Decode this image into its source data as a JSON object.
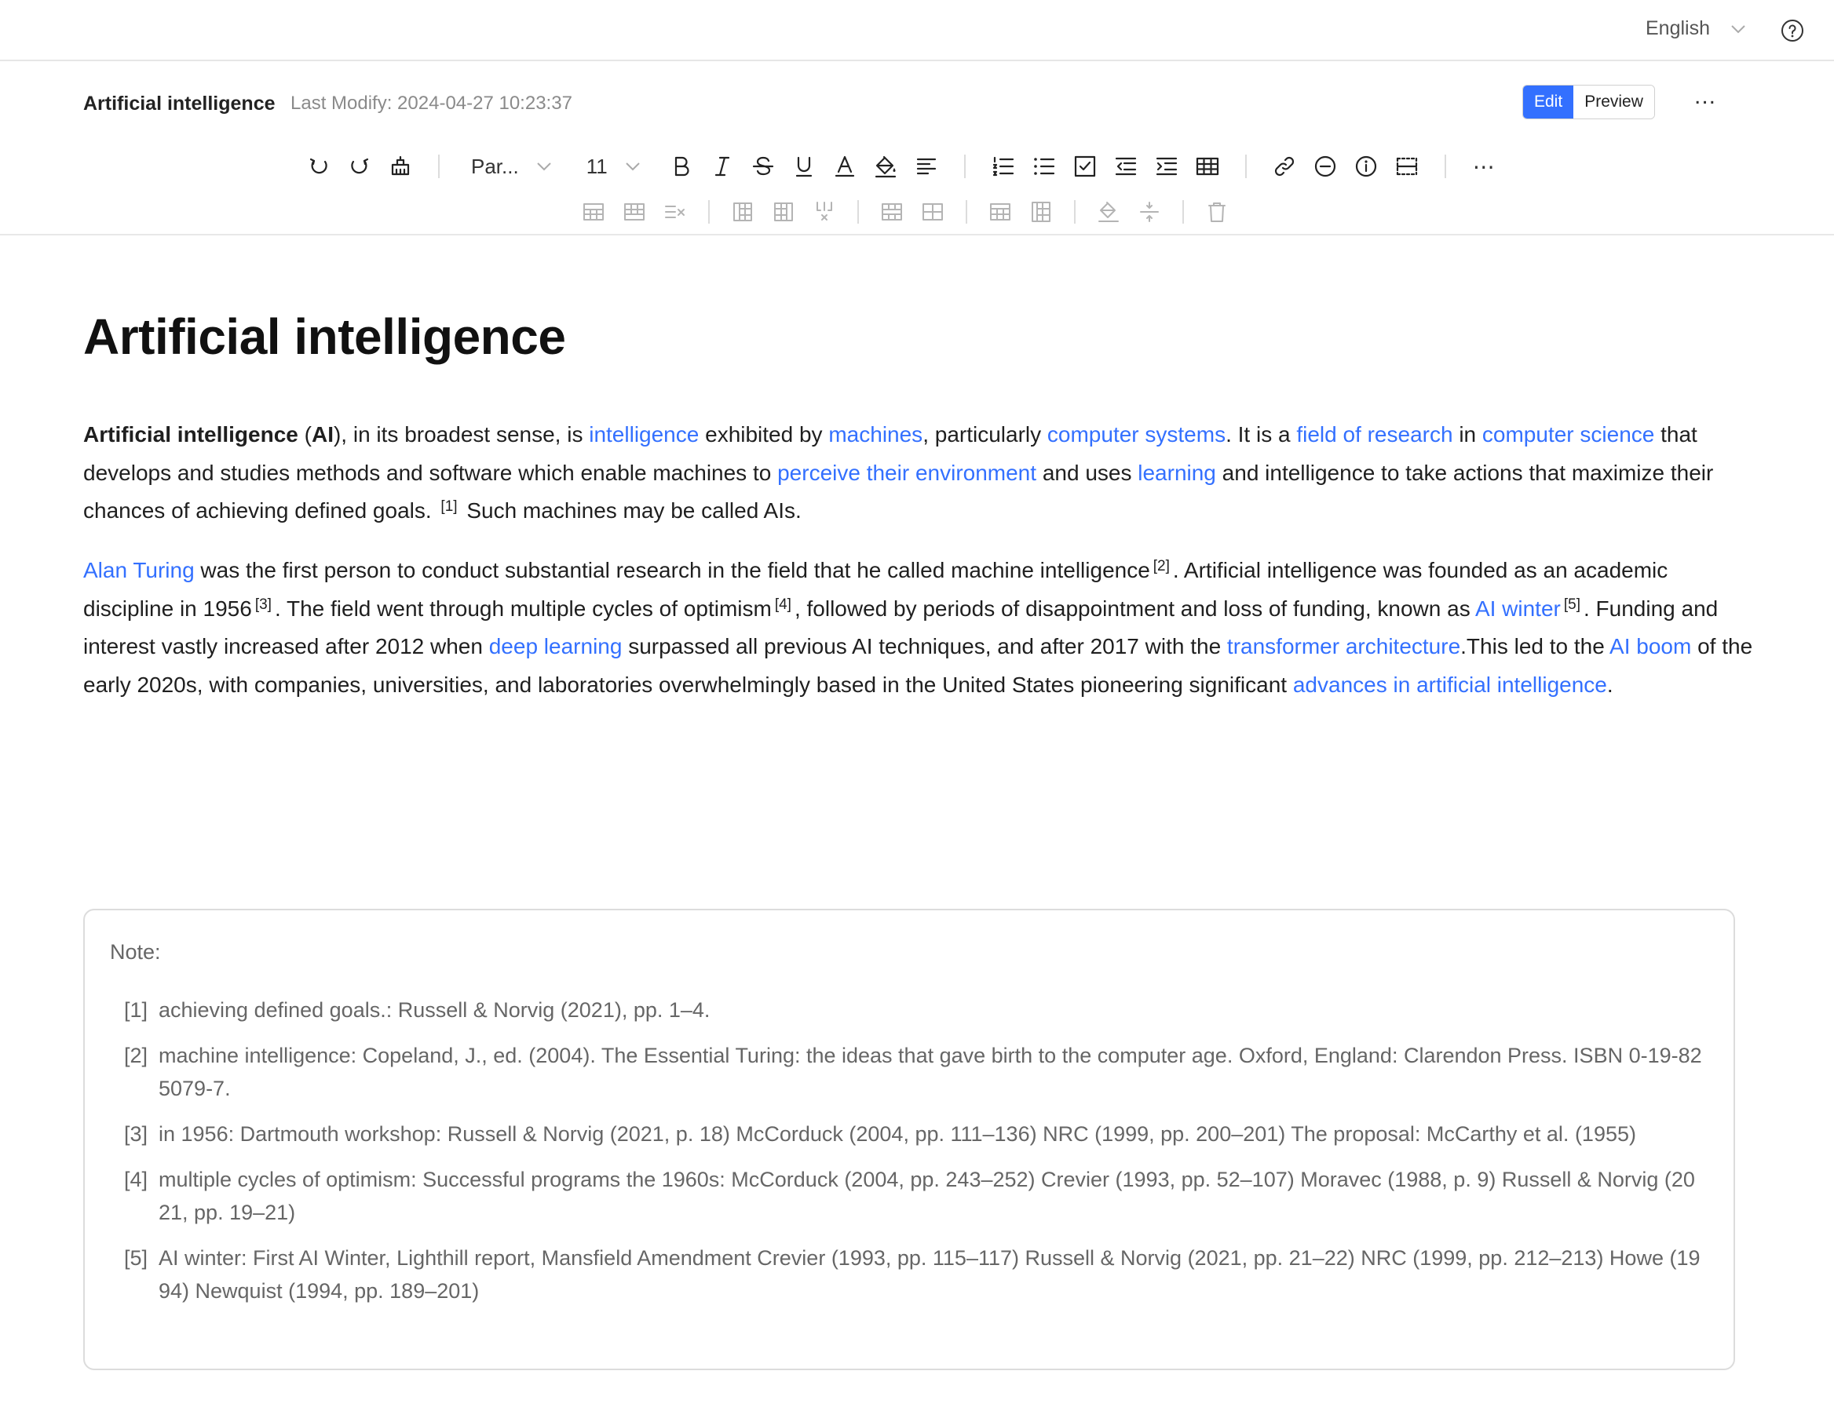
{
  "topbar": {
    "language": "English"
  },
  "header": {
    "doc_name": "Artificial intelligence",
    "last_modify": "Last Modify: 2024-04-27 10:23:37",
    "edit_label": "Edit",
    "preview_label": "Preview",
    "more_label": "..."
  },
  "toolbar": {
    "paragraph_select": "Par...",
    "font_size": "11",
    "more_label": "⋯",
    "icons_row1": [
      "undo-icon",
      "redo-icon",
      "clear-format-icon",
      "bold-icon",
      "italic-icon",
      "strikethrough-icon",
      "underline-icon",
      "font-color-icon",
      "highlight-icon",
      "align-icon",
      "ordered-list-icon",
      "bullet-list-icon",
      "checkbox-icon",
      "outdent-icon",
      "indent-icon",
      "table-icon",
      "link-icon",
      "horizontal-rule-icon",
      "info-icon",
      "select-all-icon"
    ],
    "icons_row2": [
      "insert-row-above-icon",
      "insert-row-below-icon",
      "delete-row-icon",
      "insert-column-left-icon",
      "insert-column-right-icon",
      "delete-column-icon",
      "merge-cells-icon",
      "split-cells-icon",
      "header-row-icon",
      "header-column-icon",
      "cell-fill-icon",
      "distribute-icon",
      "delete-table-icon"
    ]
  },
  "document": {
    "title": "Artificial intelligence",
    "p1": {
      "t1": "Artificial intelligence",
      "t2": " (",
      "t3": "AI",
      "t4": "), in its broadest sense, is ",
      "l1": "intelligence",
      "t5": " exhibited by ",
      "l2": "machines",
      "t6": ", particularly ",
      "l3": "computer systems",
      "t7": ". It is a ",
      "l4": "field of research",
      "t8": " in ",
      "l5": "computer science",
      "t9": " that develops and studies methods and software which enable machines to ",
      "l6": "perceive their environment",
      "t10": " and uses ",
      "l7": "learning",
      "t11": " and intelligence to take actions that maximize their chances of achieving defined goals. ",
      "r1": "[1]",
      "t12": " Such machines may be called AIs."
    },
    "p2": {
      "l1": "Alan Turing",
      "t1": " was the first person to conduct substantial research in the field that he called machine intelligence",
      "r2": "[2]",
      "t2": ". Artificial intelligence was founded as an academic discipline in 1956",
      "r3": "[3]",
      "t3": ". The field went through multiple cycles of optimism",
      "r4": "[4]",
      "t4": ", followed by periods of disappointment and loss of funding, known as ",
      "l2": "AI winter",
      "r5": "[5]",
      "t5": ". Funding and interest vastly increased after 2012 when ",
      "l3": "deep learning",
      "t6": " surpassed all previous AI techniques, and after 2017 with the ",
      "l4": "transformer architecture",
      "t7": ".This led to the ",
      "l5": "AI boom",
      "t8": " of the early 2020s, with companies, universities, and laboratories overwhelmingly based in the United States pioneering significant ",
      "l6": "advances in artificial intelligence",
      "t9": "."
    }
  },
  "note": {
    "title": "Note:",
    "items": [
      {
        "num": "[1]",
        "text": "achieving defined goals.:  Russell & Norvig (2021), pp. 1–4."
      },
      {
        "num": "[2]",
        "text": "machine intelligence:  Copeland, J., ed. (2004). The Essential Turing: the ideas that gave birth to the computer age. Oxford, England: Clarendon Press. ISBN 0-19-825079-7."
      },
      {
        "num": "[3]",
        "text": "in 1956:  Dartmouth workshop: Russell & Norvig (2021, p. 18) McCorduck (2004, pp. 111–136) NRC (1999, pp. 200–201) The proposal: McCarthy et al. (1955)"
      },
      {
        "num": "[4]",
        "text": "multiple cycles of optimism:  Successful programs the 1960s: McCorduck (2004, pp. 243–252) Crevier (1993, pp. 52–107) Moravec (1988, p. 9) Russell & Norvig (2021, pp. 19–21)"
      },
      {
        "num": "[5]",
        "text": "AI winter:  First AI Winter, Lighthill report, Mansfield Amendment Crevier (1993, pp. 115–117) Russell & Norvig (2021, pp. 21–22) NRC (1999, pp. 212–213) Howe (1994) Newquist (1994, pp. 189–201)"
      }
    ]
  }
}
